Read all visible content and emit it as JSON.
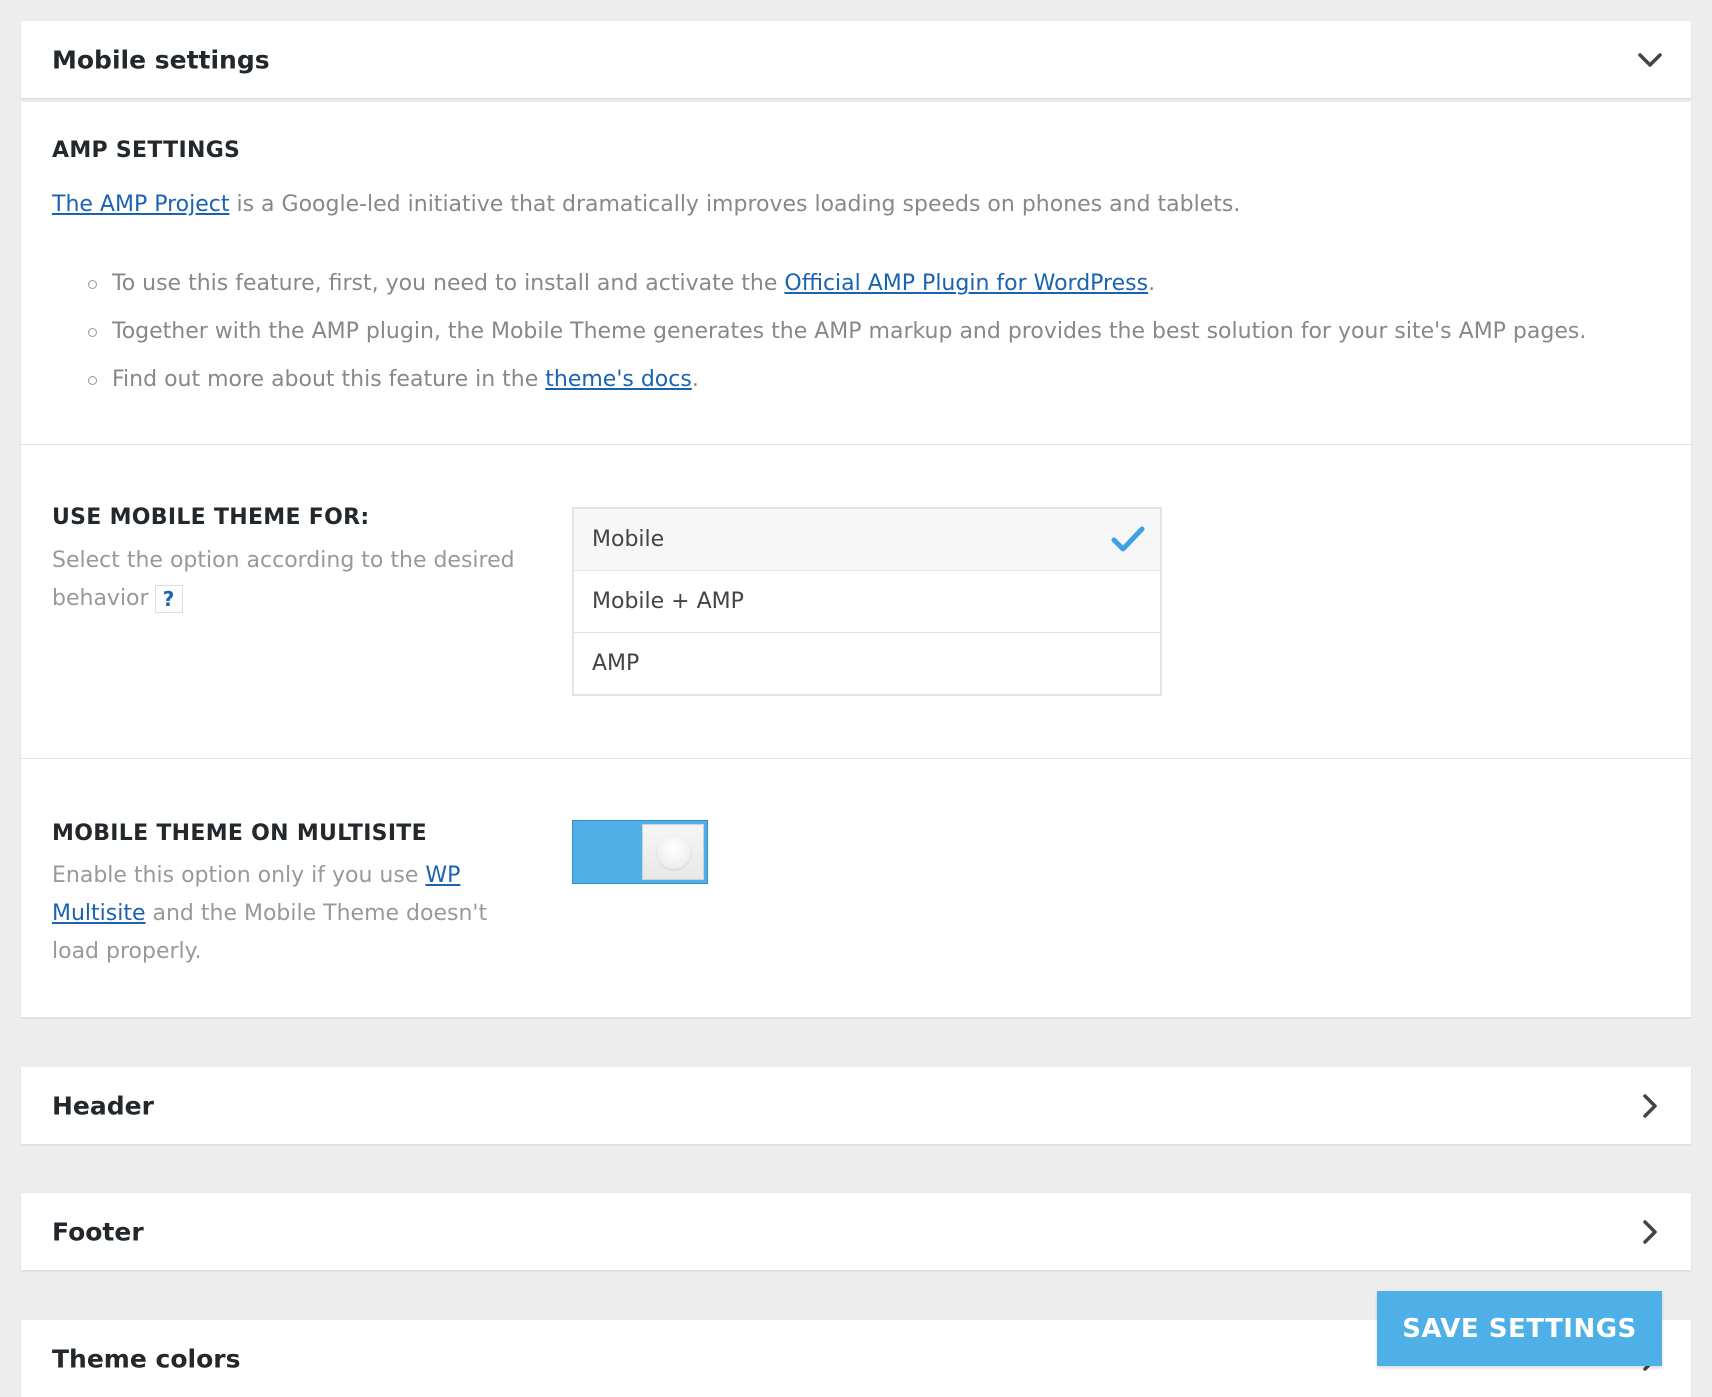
{
  "mobile_panel": {
    "title": "Mobile settings",
    "chevron_icon": "chevron-down-icon"
  },
  "amp": {
    "heading": "AMP SETTINGS",
    "intro_link": "The AMP Project",
    "intro_text": " is a Google-led initiative that dramatically improves loading speeds on phones and tablets.",
    "bullets": [
      {
        "before": "To use this feature, first, you need to install and activate the ",
        "link": "Official AMP Plugin for WordPress",
        "after": "."
      },
      {
        "before": "Together with the AMP plugin, the Mobile Theme generates the AMP markup and provides the best solution for your site's AMP pages.",
        "link": "",
        "after": ""
      },
      {
        "before": "Find out more about this feature in the ",
        "link": "theme's docs",
        "after": "."
      }
    ]
  },
  "use_for": {
    "heading": "USE MOBILE THEME FOR:",
    "desc": "Select the option according to the desired behavior",
    "help": "?",
    "options": [
      "Mobile",
      "Mobile + AMP",
      "AMP"
    ],
    "selected_index": 0,
    "check_icon": "checkmark-icon",
    "check_color": "#3aa3e3"
  },
  "multisite": {
    "heading": "MOBILE THEME ON MULTISITE",
    "desc_before": "Enable this option only if you use ",
    "desc_link": "WP Multisite",
    "desc_after": " and the Mobile Theme doesn't load properly.",
    "toggle_on": true,
    "toggle_color": "#4fb0e8"
  },
  "panels": [
    {
      "title": "Header",
      "icon": "chevron-right-icon"
    },
    {
      "title": "Footer",
      "icon": "chevron-right-icon"
    },
    {
      "title": "Theme colors",
      "icon": "chevron-right-icon"
    }
  ],
  "save_button": "SAVE SETTINGS",
  "accent_color": "#4fb0e8",
  "link_color": "#1a63b3"
}
